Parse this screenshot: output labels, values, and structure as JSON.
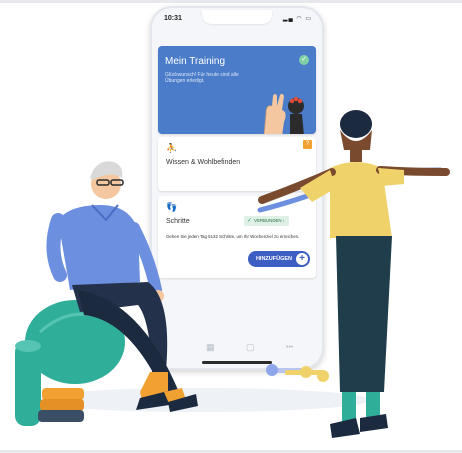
{
  "status_bar": {
    "time": "10:31",
    "icons": "▂▄ ◠ ▭"
  },
  "cards": {
    "training": {
      "title": "Mein Training",
      "subtitle": "Glückwunsch! Für heute sind alle Übungen erledigt."
    },
    "wissen": {
      "label": "Wissen & Wohlbefinden",
      "badge": "?"
    },
    "schritte": {
      "label": "Schritte",
      "connected_label": "VERBUNDEN",
      "description": "Gehen Sie jeden Tag 5132 Schritte, um Ihr Wochenziel zu erreichen.",
      "add_button": "HINZUFÜGEN"
    }
  },
  "tabbar": [
    "▦",
    "▢",
    "•••"
  ],
  "colors": {
    "accent_blue": "#4a7cc9",
    "button_blue": "#3d5ec2",
    "success_green": "#7fd1a5",
    "badge_orange": "#f0a132",
    "ball_teal": "#2fae9a"
  },
  "icons": {
    "check": "check-icon",
    "walk": "steps-icon",
    "meditation": "wellbeing-icon",
    "arrow": "arrow-right-icon",
    "plus": "plus-icon"
  }
}
